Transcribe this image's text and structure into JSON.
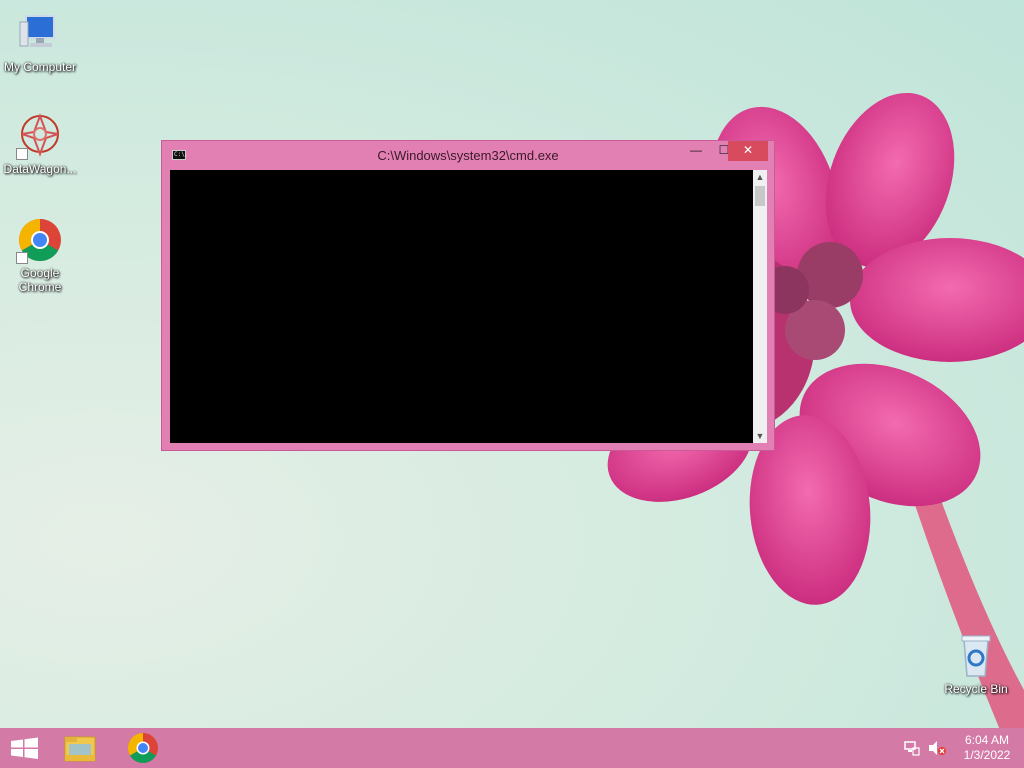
{
  "desktop": {
    "icons": [
      {
        "label": "My Computer"
      },
      {
        "label": "DataWagon..."
      },
      {
        "label": "Google Chrome"
      },
      {
        "label": "Recycle Bin"
      }
    ]
  },
  "cmd_window": {
    "title": "C:\\Windows\\system32\\cmd.exe",
    "app_icon_text": "C:\\.",
    "minimize_glyph": "—",
    "maximize_glyph": "☐",
    "close_glyph": "✕",
    "scroll_up_glyph": "▲",
    "scroll_down_glyph": "▼"
  },
  "taskbar": {
    "items": [
      "start-button",
      "file-explorer",
      "google-chrome"
    ],
    "tray": {
      "time": "6:04 AM",
      "date": "1/3/2022"
    }
  },
  "colors": {
    "taskbar": "#d37aa7",
    "window_frame": "#e27fb3",
    "close_button": "#d84b5f",
    "console_background": "#000000"
  }
}
